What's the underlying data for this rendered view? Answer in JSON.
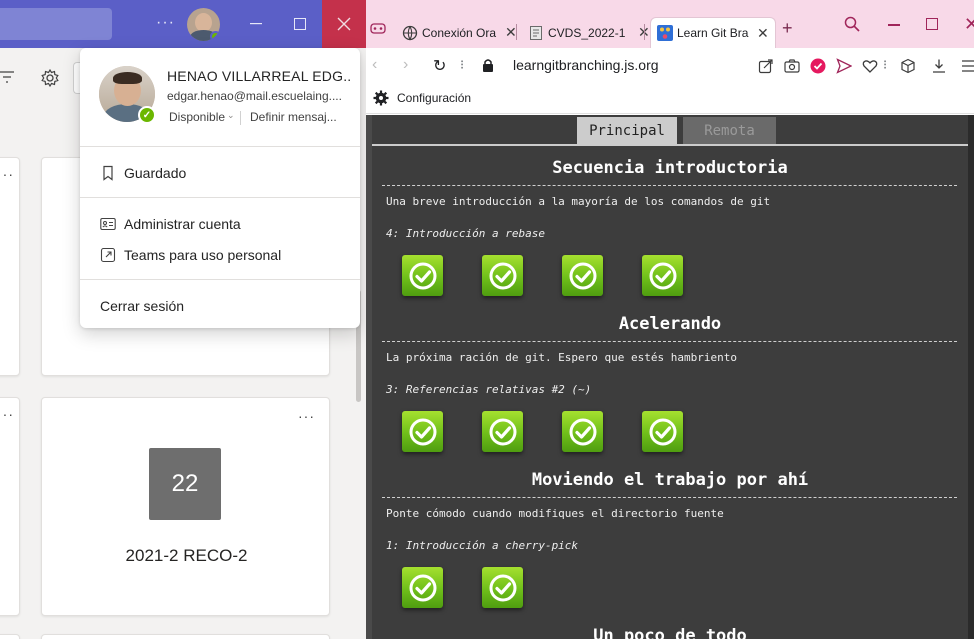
{
  "teams": {
    "profile": {
      "name": "HENAO VILLARREAL EDG...",
      "email": "edgar.henao@mail.escuelaing....",
      "availability": "Disponible",
      "set_message": "Definir mensaj..."
    },
    "menu": {
      "saved": "Guardado",
      "manage_account": "Administrar cuenta",
      "personal": "Teams para uso personal",
      "sign_out": "Cerrar sesión"
    },
    "team_card": {
      "tile_text": "22",
      "name": "2021-2 RECO-2"
    },
    "more_label": "···",
    "card_dots": "···",
    "accent_color": "#5b5fc7",
    "status_color": "#6bb700"
  },
  "browser": {
    "tabs": [
      {
        "title": "Conexión Ora",
        "icon": "globe-icon"
      },
      {
        "title": "CVDS_2022-1",
        "icon": "document-icon"
      },
      {
        "title": "Learn Git Brar",
        "icon": "git-icon",
        "active": true
      }
    ],
    "url": "learngitbranching.js.org",
    "bookmark": "Configuración",
    "theme_color": "#f8d9e8"
  },
  "page": {
    "tabs": {
      "principal": "Principal",
      "remota": "Remota"
    },
    "sequences": [
      {
        "title": "Secuencia introductoria",
        "description": "Una breve introducción a la mayoría de los comandos de git",
        "level": "4: Introducción a rebase",
        "completed": 4
      },
      {
        "title": "Acelerando",
        "description": "La próxima ración de git. Espero que estés hambriento",
        "level": "3: Referencias relativas #2 (~)",
        "completed": 4
      },
      {
        "title": "Moviendo el trabajo por ahí",
        "description": "Ponte cómodo cuando modifiques el directorio fuente",
        "level": "1: Introducción a cherry-pick",
        "completed": 2
      },
      {
        "title": "Un poco de todo"
      }
    ]
  }
}
